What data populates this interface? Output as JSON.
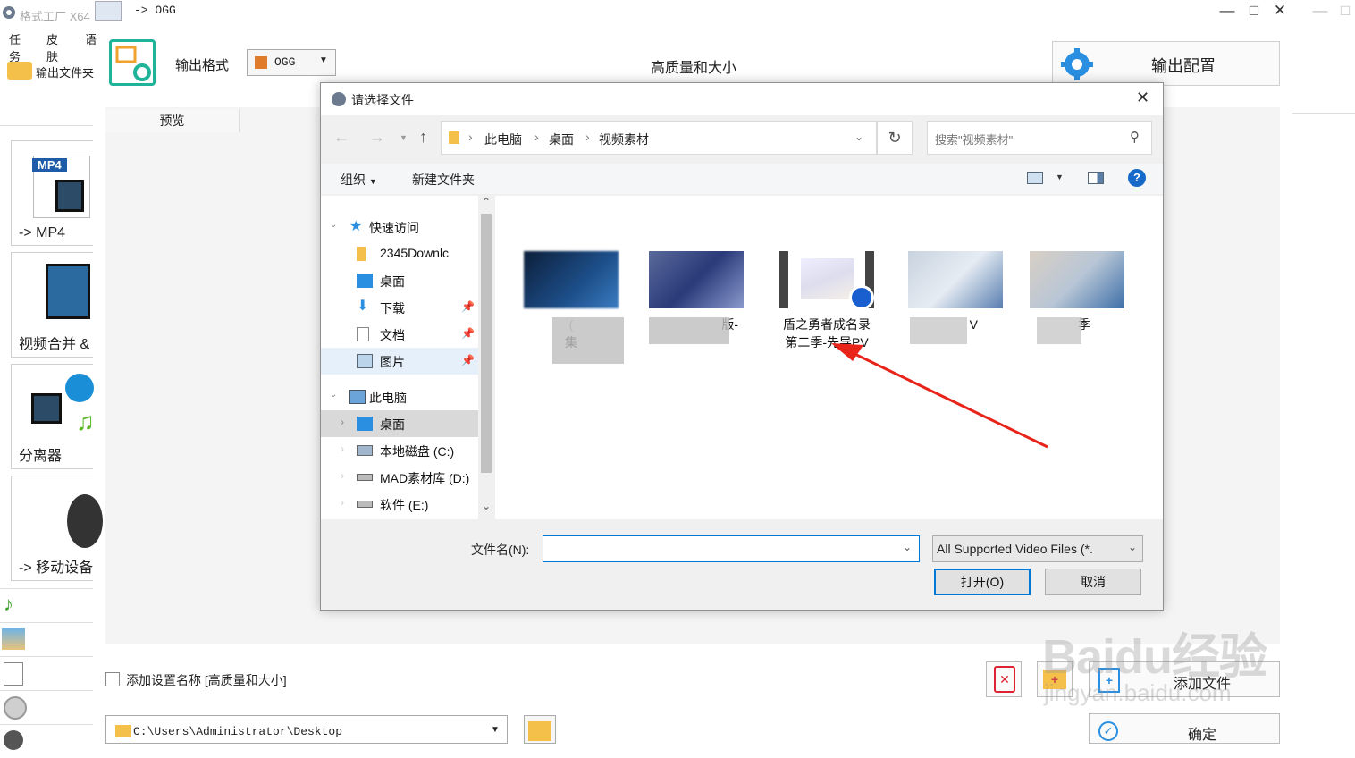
{
  "app": {
    "title": "格式工厂 X64",
    "subtitle": "-> OGG",
    "menu": [
      "任务",
      "皮肤",
      "语"
    ],
    "output_folder_label": "输出文件夹",
    "output_format_label": "输出格式",
    "format_value": "OGG",
    "quality_label": "高质量和大小",
    "config_button": "输出配置",
    "preview_tab": "预览",
    "tiles": [
      "-> MP4",
      "视频合并 &",
      "分离器",
      "-> 移动设备"
    ],
    "mp4_badge": "MP4",
    "add_setting_name_label": "添加设置名称 [高质量和大小]",
    "add_file_button": "添加文件",
    "confirm_button": "确定",
    "output_path": "C:\\Users\\Administrator\\Desktop",
    "watermark_main": "Baidu经验",
    "watermark_sub": "jingyan.baidu.com"
  },
  "dialog": {
    "title": "请选择文件",
    "breadcrumb": [
      "此电脑",
      "桌面",
      "视频素材"
    ],
    "search_placeholder": "搜索\"视频素材\"",
    "organize": "组织",
    "new_folder": "新建文件夹",
    "help": "?",
    "nav": {
      "quick_access": "快速访问",
      "items": [
        "2345Downlc",
        "桌面",
        "下载",
        "文档",
        "图片"
      ],
      "this_pc": "此电脑",
      "pc_items": [
        "桌面",
        "本地磁盘 (C:)",
        "MAD素材库 (D:)",
        "软件 (E:)"
      ]
    },
    "files": [
      {
        "name_line1": "(",
        "name_line2": "集"
      },
      {
        "name_line1": "",
        "name_line2": "版-"
      },
      {
        "name_line1": "盾之勇者成名录",
        "name_line2": "第二季-先导PV"
      },
      {
        "name_line1": "",
        "name_line2": "V"
      },
      {
        "name_line1": "",
        "name_line2": "季"
      }
    ],
    "filename_label": "文件名(N):",
    "filename_value": "",
    "filter_value": "All Supported Video Files (*.",
    "open_button": "打开(O)",
    "cancel_button": "取消"
  },
  "colors": {
    "accent": "#0078d7",
    "arrow": "#e8231a",
    "teal": "#1fb39a",
    "help": "#1769c9"
  }
}
